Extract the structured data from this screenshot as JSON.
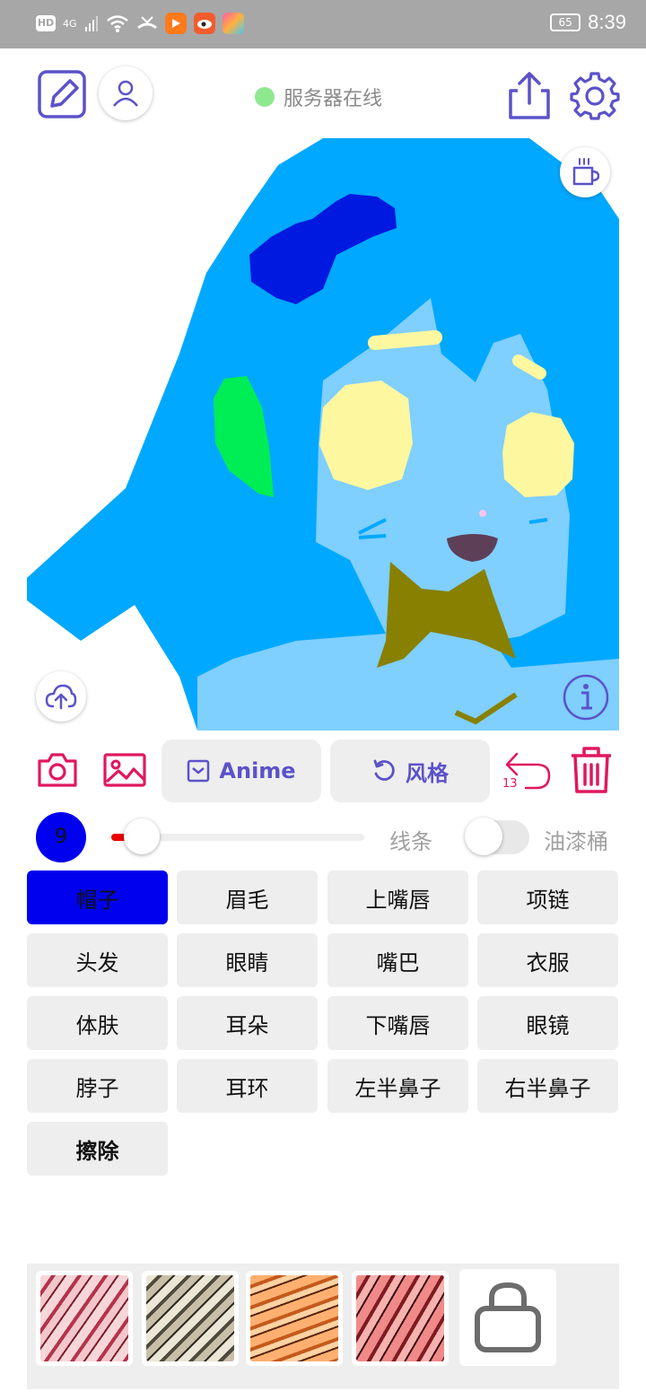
{
  "status_bar": {
    "network": "4G",
    "battery": "65",
    "time": "8:39"
  },
  "header": {
    "server_status": "服务器在线",
    "server_status_color": "#8ee88e"
  },
  "toolbar": {
    "anime_label": "Anime",
    "style_label": "风格",
    "undo_count": "13"
  },
  "brush": {
    "size": "9",
    "line_label": "线条",
    "bucket_label": "油漆桶",
    "slider_fraction": 0.12,
    "bucket_on": false
  },
  "parts": {
    "items": [
      {
        "label": "帽子"
      },
      {
        "label": "眉毛"
      },
      {
        "label": "上嘴唇"
      },
      {
        "label": "项链"
      },
      {
        "label": "头发"
      },
      {
        "label": "眼睛"
      },
      {
        "label": "嘴巴"
      },
      {
        "label": "衣服"
      },
      {
        "label": "体肤"
      },
      {
        "label": "耳朵"
      },
      {
        "label": "下嘴唇"
      },
      {
        "label": "眼镜"
      },
      {
        "label": "脖子"
      },
      {
        "label": "耳环"
      },
      {
        "label": "左半鼻子"
      },
      {
        "label": "右半鼻子"
      },
      {
        "label": "擦除"
      }
    ],
    "selected": "帽子",
    "selected_color": "#0000ee"
  },
  "colors": {
    "accent": "#5b52c9",
    "danger": "#e0175f",
    "hair": "#00a8ff",
    "skin": "#7fcfff",
    "bow": "#0019e0",
    "ear": "#00ee55",
    "eye": "#fdf7a0",
    "neck": "#888000",
    "mouth": "#5d3f58"
  },
  "style_tray": {
    "thumbnails": [
      "style-red-1",
      "style-grey",
      "style-orange",
      "style-red-2"
    ],
    "shop_icon": "bag-icon"
  }
}
